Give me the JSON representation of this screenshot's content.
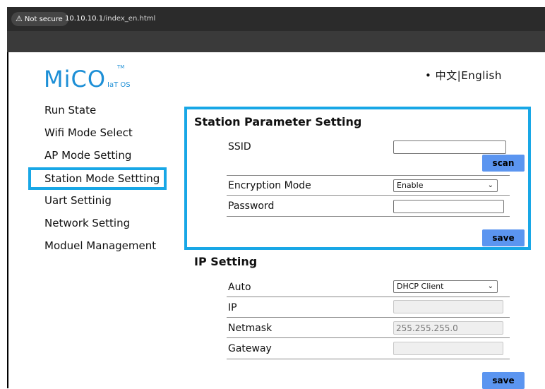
{
  "browser": {
    "security_label": "Not secure",
    "url_host": "10.10.10.1",
    "url_path": "/index_en.html"
  },
  "logo": {
    "main": "MiCO",
    "sub": "IaT OS",
    "tm": "TM"
  },
  "language": {
    "bullet": "•",
    "zh": "中文",
    "sep": "|",
    "en": "English"
  },
  "sidebar": {
    "items": [
      {
        "label": "Run State"
      },
      {
        "label": "Wifi Mode Select"
      },
      {
        "label": "AP Mode Setting"
      },
      {
        "label": "Station Mode Settting"
      },
      {
        "label": "Uart Settinig"
      },
      {
        "label": "Network Setting"
      },
      {
        "label": "Moduel Management"
      }
    ]
  },
  "station": {
    "title": "Station Parameter Setting",
    "ssid_label": "SSID",
    "ssid_value": "",
    "scan_button": "scan",
    "encryption_label": "Encryption Mode",
    "encryption_value": "Enable",
    "password_label": "Password",
    "password_value": "",
    "save_button": "save"
  },
  "ip": {
    "title": "IP Setting",
    "auto_label": "Auto",
    "auto_value": "DHCP Client",
    "ip_label": "IP",
    "ip_value": "",
    "netmask_label": "Netmask",
    "netmask_value": "255.255.255.0",
    "gateway_label": "Gateway",
    "gateway_value": "",
    "save_button": "save"
  },
  "colors": {
    "highlight": "#18a7e6",
    "button": "#5b95f0",
    "logo": "#1d8fd6"
  }
}
